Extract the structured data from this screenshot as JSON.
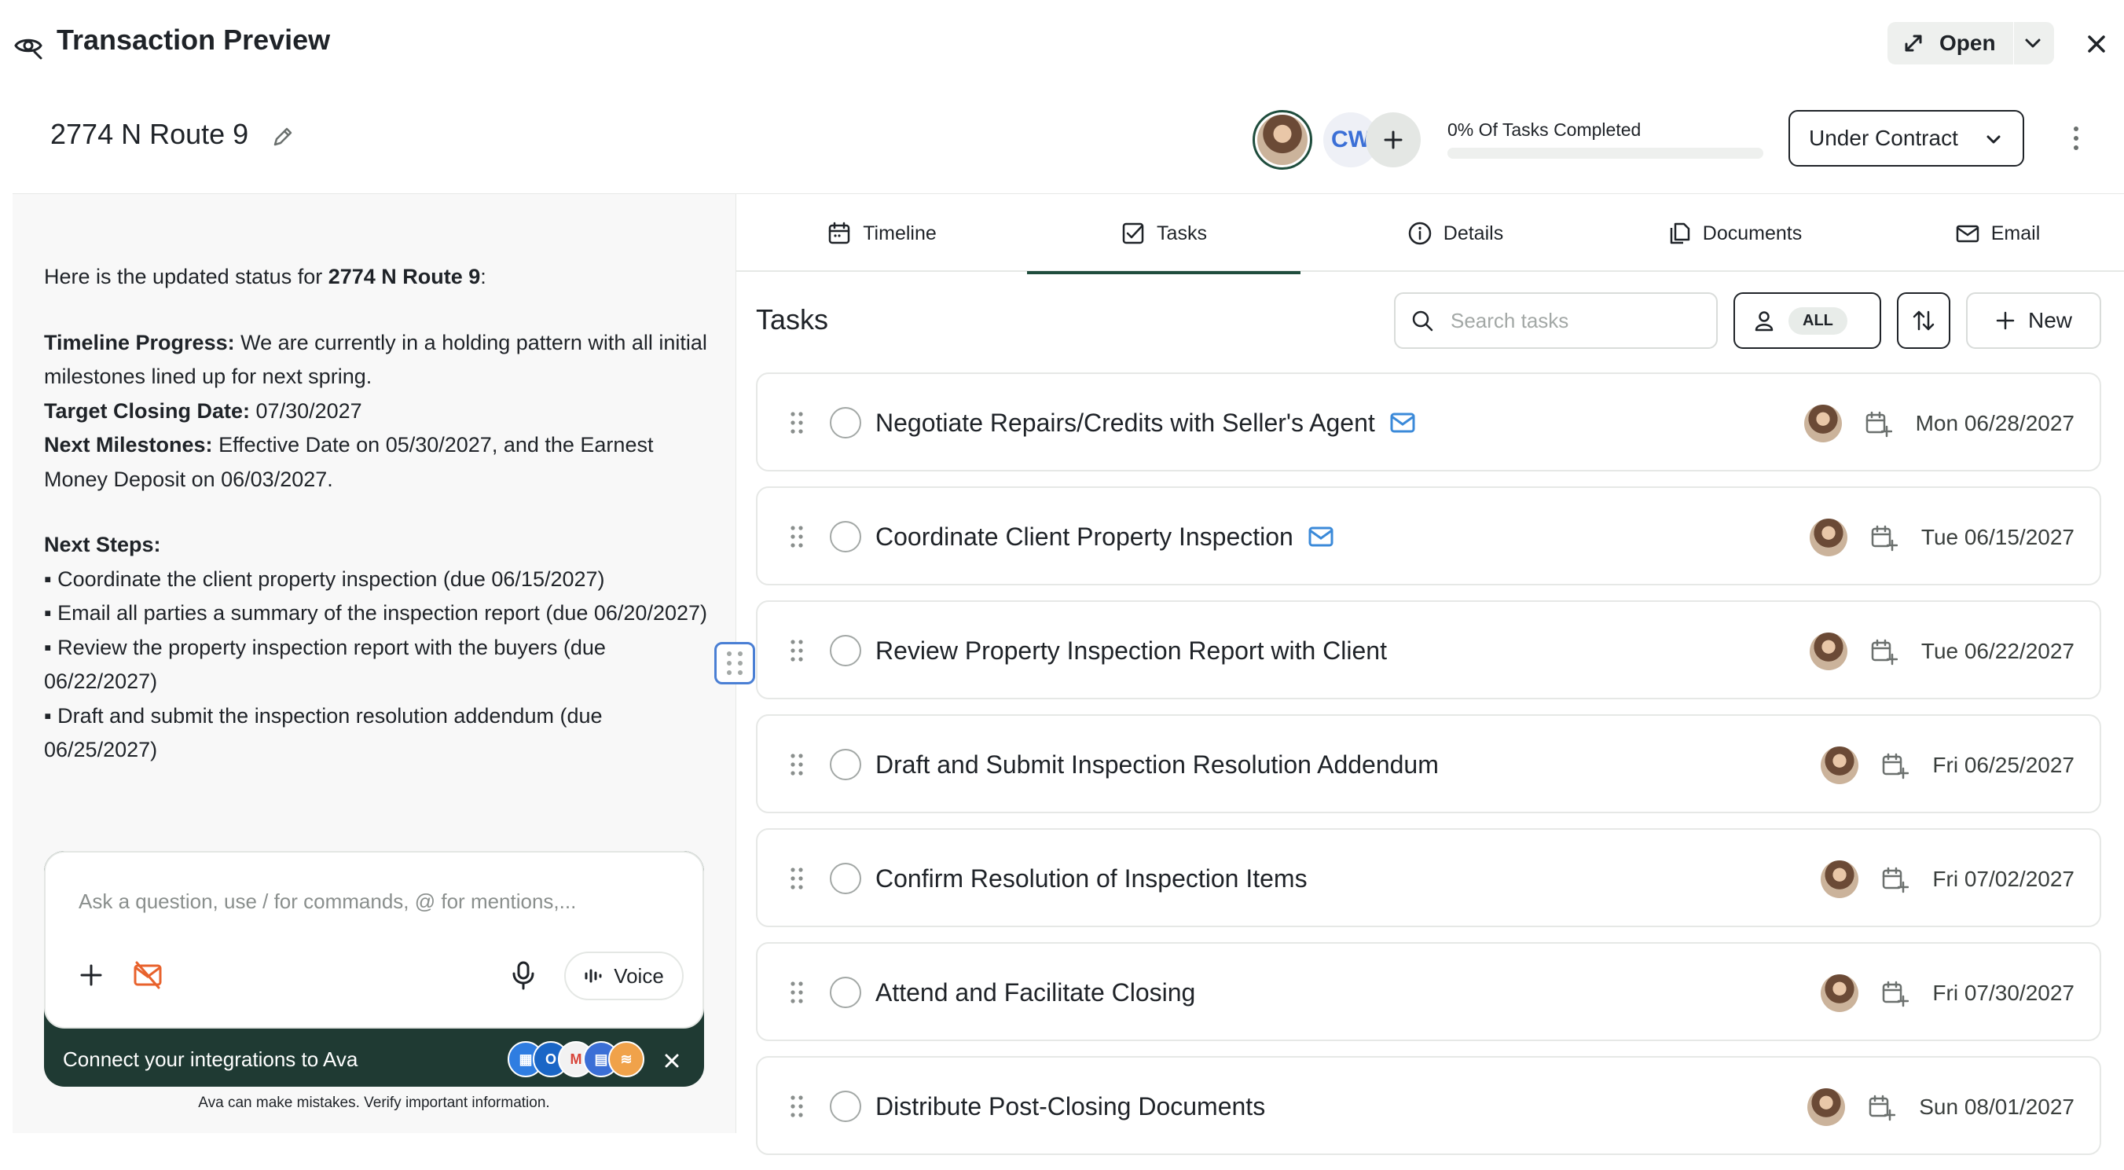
{
  "window": {
    "title": "Transaction Preview",
    "open_label": "Open"
  },
  "header": {
    "address": "2774 N Route 9",
    "collaborator_initials": "CW",
    "progress_label": "0% Of Tasks Completed",
    "progress_fraction": 0,
    "status": "Under Contract"
  },
  "chat": {
    "intro_prefix": "Here is the updated status for ",
    "intro_address": "2774 N Route 9",
    "intro_suffix": ":",
    "timeline_label": "Timeline Progress:",
    "timeline_text": " We are currently in a holding pattern with all initial milestones lined up for next spring.",
    "closing_label": "Target Closing Date:",
    "closing_text": " 07/30/2027",
    "milestones_label": "Next Milestones:",
    "milestones_text": " Effective Date on 05/30/2027, and the Earnest Money Deposit on 06/03/2027.",
    "next_steps_label": "Next Steps:",
    "steps": [
      "▪ Coordinate the client property inspection (due 06/15/2027)",
      "▪ Email all parties a summary of the inspection report (due 06/20/2027)",
      "▪ Review the property inspection report with the buyers (due 06/22/2027)",
      "▪ Draft and submit the inspection resolution addendum (due 06/25/2027)"
    ],
    "input_placeholder": "Ask a question, use / for commands, @ for mentions,...",
    "voice_label": "Voice",
    "connect_text": "Connect your integrations to Ava",
    "disclaimer": "Ava can make mistakes. Verify important information."
  },
  "tabs": [
    {
      "label": "Timeline",
      "icon": "calendar-icon"
    },
    {
      "label": "Tasks",
      "icon": "checkbox-icon"
    },
    {
      "label": "Details",
      "icon": "info-icon"
    },
    {
      "label": "Documents",
      "icon": "documents-icon"
    },
    {
      "label": "Email",
      "icon": "email-icon"
    }
  ],
  "tasks": {
    "title": "Tasks",
    "search_placeholder": "Search tasks",
    "filter_label": "ALL",
    "new_label": "New",
    "items": [
      {
        "title": "Negotiate Repairs/Credits with Seller's Agent",
        "date": "Mon 06/28/2027",
        "has_email": true
      },
      {
        "title": "Coordinate Client Property Inspection",
        "date": "Tue 06/15/2027",
        "has_email": true
      },
      {
        "title": "Review Property Inspection Report with Client",
        "date": "Tue 06/22/2027",
        "has_email": false
      },
      {
        "title": "Draft and Submit Inspection Resolution Addendum",
        "date": "Fri 06/25/2027",
        "has_email": false
      },
      {
        "title": "Confirm Resolution of Inspection Items",
        "date": "Fri 07/02/2027",
        "has_email": false
      },
      {
        "title": "Attend and Facilitate Closing",
        "date": "Fri 07/30/2027",
        "has_email": false
      },
      {
        "title": "Distribute Post-Closing Documents",
        "date": "Sun 08/01/2027",
        "has_email": false
      }
    ]
  },
  "colors": {
    "brand_dark_green": "#1f4d3d",
    "composer_footer": "#1f3a33",
    "link_blue": "#3b8ad9",
    "orange_icon": "#e8622c"
  }
}
